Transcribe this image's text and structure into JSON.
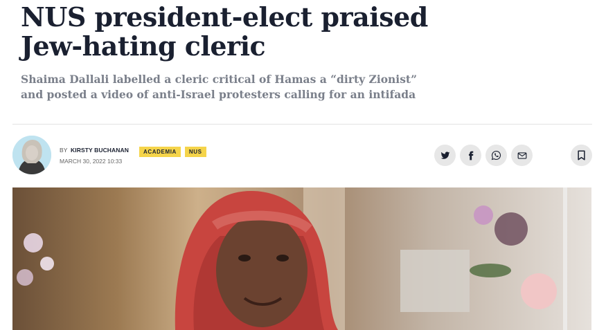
{
  "article": {
    "headline": "NUS president-elect praised Jew-hating cleric",
    "standfirst": "Shaima Dallali labelled a cleric critical of Hamas a “dirty Zionist” and posted a video of anti-Israel protesters calling for an intifada"
  },
  "byline": {
    "prefix": "BY",
    "author": "KIRSTY BUCHANAN",
    "date": "MARCH 30, 2022 10:33"
  },
  "tags": [
    "ACADEMIA",
    "NUS"
  ],
  "share_icons": [
    "twitter-icon",
    "facebook-icon",
    "whatsapp-icon",
    "email-icon"
  ],
  "bookmark_icon": "bookmark-icon",
  "colors": {
    "headline": "#1a2030",
    "standfirst": "#7a7f8a",
    "tag_background": "#f5d44a",
    "icon_circle": "#e7e7e7"
  }
}
